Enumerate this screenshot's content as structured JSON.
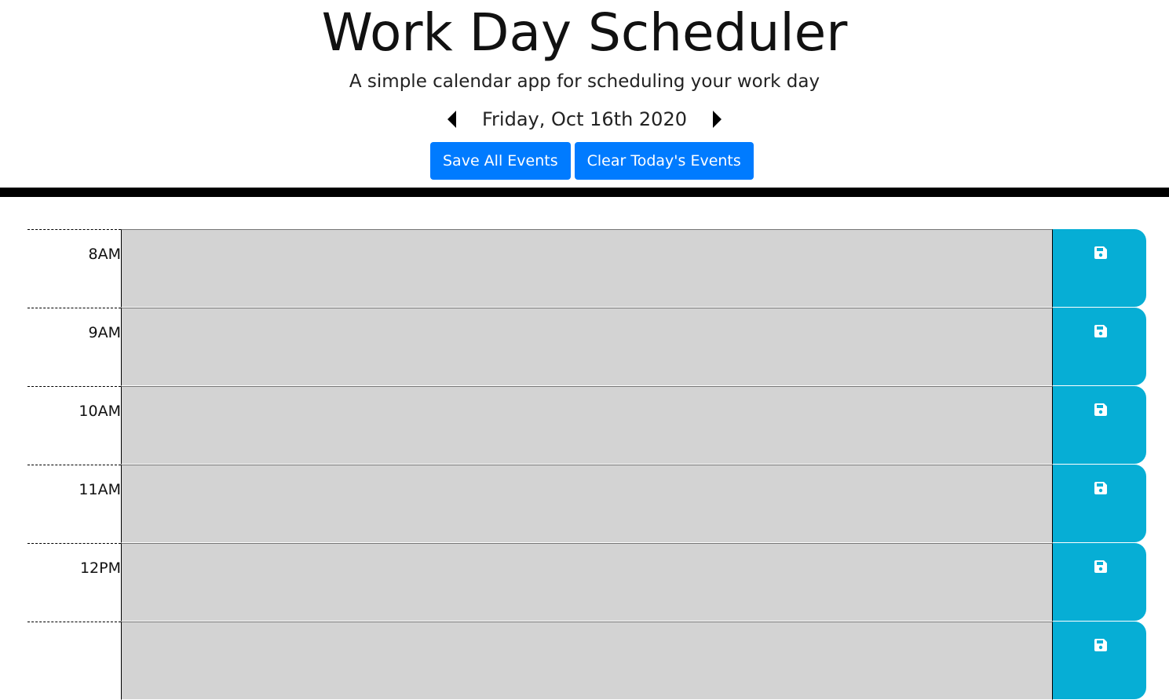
{
  "header": {
    "title": "Work Day Scheduler",
    "subtitle": "A simple calendar app for scheduling your work day"
  },
  "date_nav": {
    "current_date": "Friday, Oct 16th 2020",
    "prev_icon": "caret-left-icon",
    "next_icon": "caret-right-icon"
  },
  "actions": {
    "save_all_label": "Save All Events",
    "clear_today_label": "Clear Today's Events",
    "button_color": "#007bff"
  },
  "schedule": {
    "save_icon": "floppy-disk-icon",
    "past_color": "#d3d3d3",
    "save_color": "#06aed5",
    "rows": [
      {
        "hour": "8AM",
        "event": ""
      },
      {
        "hour": "9AM",
        "event": ""
      },
      {
        "hour": "10AM",
        "event": ""
      },
      {
        "hour": "11AM",
        "event": ""
      },
      {
        "hour": "12PM",
        "event": ""
      },
      {
        "hour": "",
        "event": ""
      }
    ]
  }
}
